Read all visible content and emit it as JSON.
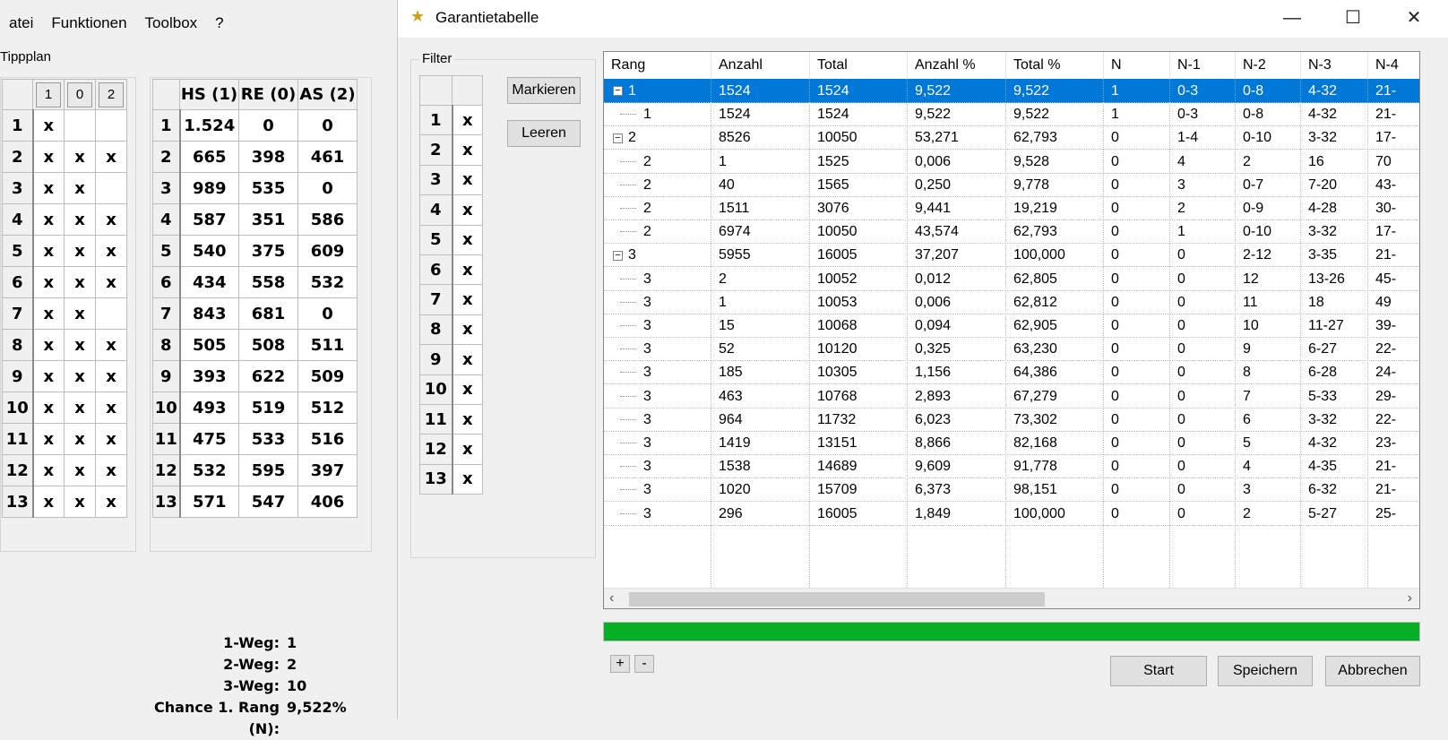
{
  "menu": [
    "atei",
    "Funktionen",
    "Toolbox",
    "?"
  ],
  "tippplan": {
    "label": "Tippplan",
    "col_headers": [
      "1",
      "0",
      "2"
    ],
    "rows": [
      {
        "n": "1",
        "c": [
          "x",
          "",
          ""
        ]
      },
      {
        "n": "2",
        "c": [
          "x",
          "x",
          "x"
        ]
      },
      {
        "n": "3",
        "c": [
          "x",
          "x",
          ""
        ]
      },
      {
        "n": "4",
        "c": [
          "x",
          "x",
          "x"
        ]
      },
      {
        "n": "5",
        "c": [
          "x",
          "x",
          "x"
        ]
      },
      {
        "n": "6",
        "c": [
          "x",
          "x",
          "x"
        ]
      },
      {
        "n": "7",
        "c": [
          "x",
          "x",
          ""
        ]
      },
      {
        "n": "8",
        "c": [
          "x",
          "x",
          "x"
        ]
      },
      {
        "n": "9",
        "c": [
          "x",
          "x",
          "x"
        ]
      },
      {
        "n": "10",
        "c": [
          "x",
          "x",
          "x"
        ]
      },
      {
        "n": "11",
        "c": [
          "x",
          "x",
          "x"
        ]
      },
      {
        "n": "12",
        "c": [
          "x",
          "x",
          "x"
        ]
      },
      {
        "n": "13",
        "c": [
          "x",
          "x",
          "x"
        ]
      }
    ]
  },
  "stats_table": {
    "headers": [
      "HS (1)",
      "RE (0)",
      "AS (2)"
    ],
    "rows": [
      {
        "n": "1",
        "v": [
          "1.524",
          "0",
          "0"
        ]
      },
      {
        "n": "2",
        "v": [
          "665",
          "398",
          "461"
        ]
      },
      {
        "n": "3",
        "v": [
          "989",
          "535",
          "0"
        ]
      },
      {
        "n": "4",
        "v": [
          "587",
          "351",
          "586"
        ]
      },
      {
        "n": "5",
        "v": [
          "540",
          "375",
          "609"
        ]
      },
      {
        "n": "6",
        "v": [
          "434",
          "558",
          "532"
        ]
      },
      {
        "n": "7",
        "v": [
          "843",
          "681",
          "0"
        ]
      },
      {
        "n": "8",
        "v": [
          "505",
          "508",
          "511"
        ]
      },
      {
        "n": "9",
        "v": [
          "393",
          "622",
          "509"
        ]
      },
      {
        "n": "10",
        "v": [
          "493",
          "519",
          "512"
        ]
      },
      {
        "n": "11",
        "v": [
          "475",
          "533",
          "516"
        ]
      },
      {
        "n": "12",
        "v": [
          "532",
          "595",
          "397"
        ]
      },
      {
        "n": "13",
        "v": [
          "571",
          "547",
          "406"
        ]
      }
    ]
  },
  "stats": [
    {
      "k": "1-Weg:",
      "v": "1"
    },
    {
      "k": "2-Weg:",
      "v": "2"
    },
    {
      "k": "3-Weg:",
      "v": "10"
    },
    {
      "k": "Chance 1. Rang (N):",
      "v": "9,522%"
    }
  ],
  "dialog": {
    "title": "Garantietabelle",
    "filter_label": "Filter",
    "filter_rows": [
      {
        "n": "1",
        "v": "x"
      },
      {
        "n": "2",
        "v": "x"
      },
      {
        "n": "3",
        "v": "x"
      },
      {
        "n": "4",
        "v": "x"
      },
      {
        "n": "5",
        "v": "x"
      },
      {
        "n": "6",
        "v": "x"
      },
      {
        "n": "7",
        "v": "x"
      },
      {
        "n": "8",
        "v": "x"
      },
      {
        "n": "9",
        "v": "x"
      },
      {
        "n": "10",
        "v": "x"
      },
      {
        "n": "11",
        "v": "x"
      },
      {
        "n": "12",
        "v": "x"
      },
      {
        "n": "13",
        "v": "x"
      }
    ],
    "markieren": "Markieren",
    "leeren": "Leeren",
    "columns": [
      "Rang",
      "Anzahl",
      "Total",
      "Anzahl %",
      "Total %",
      "N",
      "N-1",
      "N-2",
      "N-3",
      "N-4"
    ],
    "rows": [
      {
        "level": 0,
        "exp": true,
        "sel": true,
        "c": [
          "1",
          "1524",
          "1524",
          "9,522",
          "9,522",
          "1",
          "0-3",
          "0-8",
          "4-32",
          "21-"
        ]
      },
      {
        "level": 1,
        "c": [
          "1",
          "1524",
          "1524",
          "9,522",
          "9,522",
          "1",
          "0-3",
          "0-8",
          "4-32",
          "21-"
        ]
      },
      {
        "level": 0,
        "exp": true,
        "c": [
          "2",
          "8526",
          "10050",
          "53,271",
          "62,793",
          "0",
          "1-4",
          "0-10",
          "3-32",
          "17-"
        ]
      },
      {
        "level": 1,
        "c": [
          "2",
          "1",
          "1525",
          "0,006",
          "9,528",
          "0",
          "4",
          "2",
          "16",
          "70"
        ]
      },
      {
        "level": 1,
        "c": [
          "2",
          "40",
          "1565",
          "0,250",
          "9,778",
          "0",
          "3",
          "0-7",
          "7-20",
          "43-"
        ]
      },
      {
        "level": 1,
        "c": [
          "2",
          "1511",
          "3076",
          "9,441",
          "19,219",
          "0",
          "2",
          "0-9",
          "4-28",
          "30-"
        ]
      },
      {
        "level": 1,
        "c": [
          "2",
          "6974",
          "10050",
          "43,574",
          "62,793",
          "0",
          "1",
          "0-10",
          "3-32",
          "17-"
        ]
      },
      {
        "level": 0,
        "exp": true,
        "c": [
          "3",
          "5955",
          "16005",
          "37,207",
          "100,000",
          "0",
          "0",
          "2-12",
          "3-35",
          "21-"
        ]
      },
      {
        "level": 1,
        "c": [
          "3",
          "2",
          "10052",
          "0,012",
          "62,805",
          "0",
          "0",
          "12",
          "13-26",
          "45-"
        ]
      },
      {
        "level": 1,
        "c": [
          "3",
          "1",
          "10053",
          "0,006",
          "62,812",
          "0",
          "0",
          "11",
          "18",
          "49"
        ]
      },
      {
        "level": 1,
        "c": [
          "3",
          "15",
          "10068",
          "0,094",
          "62,905",
          "0",
          "0",
          "10",
          "11-27",
          "39-"
        ]
      },
      {
        "level": 1,
        "c": [
          "3",
          "52",
          "10120",
          "0,325",
          "63,230",
          "0",
          "0",
          "9",
          "6-27",
          "22-"
        ]
      },
      {
        "level": 1,
        "c": [
          "3",
          "185",
          "10305",
          "1,156",
          "64,386",
          "0",
          "0",
          "8",
          "6-28",
          "24-"
        ]
      },
      {
        "level": 1,
        "c": [
          "3",
          "463",
          "10768",
          "2,893",
          "67,279",
          "0",
          "0",
          "7",
          "5-33",
          "29-"
        ]
      },
      {
        "level": 1,
        "c": [
          "3",
          "964",
          "11732",
          "6,023",
          "73,302",
          "0",
          "0",
          "6",
          "3-32",
          "22-"
        ]
      },
      {
        "level": 1,
        "c": [
          "3",
          "1419",
          "13151",
          "8,866",
          "82,168",
          "0",
          "0",
          "5",
          "4-32",
          "23-"
        ]
      },
      {
        "level": 1,
        "c": [
          "3",
          "1538",
          "14689",
          "9,609",
          "91,778",
          "0",
          "0",
          "4",
          "4-35",
          "21-"
        ]
      },
      {
        "level": 1,
        "c": [
          "3",
          "1020",
          "15709",
          "6,373",
          "98,151",
          "0",
          "0",
          "3",
          "6-32",
          "21-"
        ]
      },
      {
        "level": 1,
        "c": [
          "3",
          "296",
          "16005",
          "1,849",
          "100,000",
          "0",
          "0",
          "2",
          "5-27",
          "25-"
        ]
      }
    ],
    "progress": 1.0,
    "plus": "+",
    "minus": "-",
    "start": "Start",
    "speichern": "Speichern",
    "abbrechen": "Abbrechen"
  },
  "colors": {
    "selection": "#0078d7",
    "progress": "#06b025"
  }
}
